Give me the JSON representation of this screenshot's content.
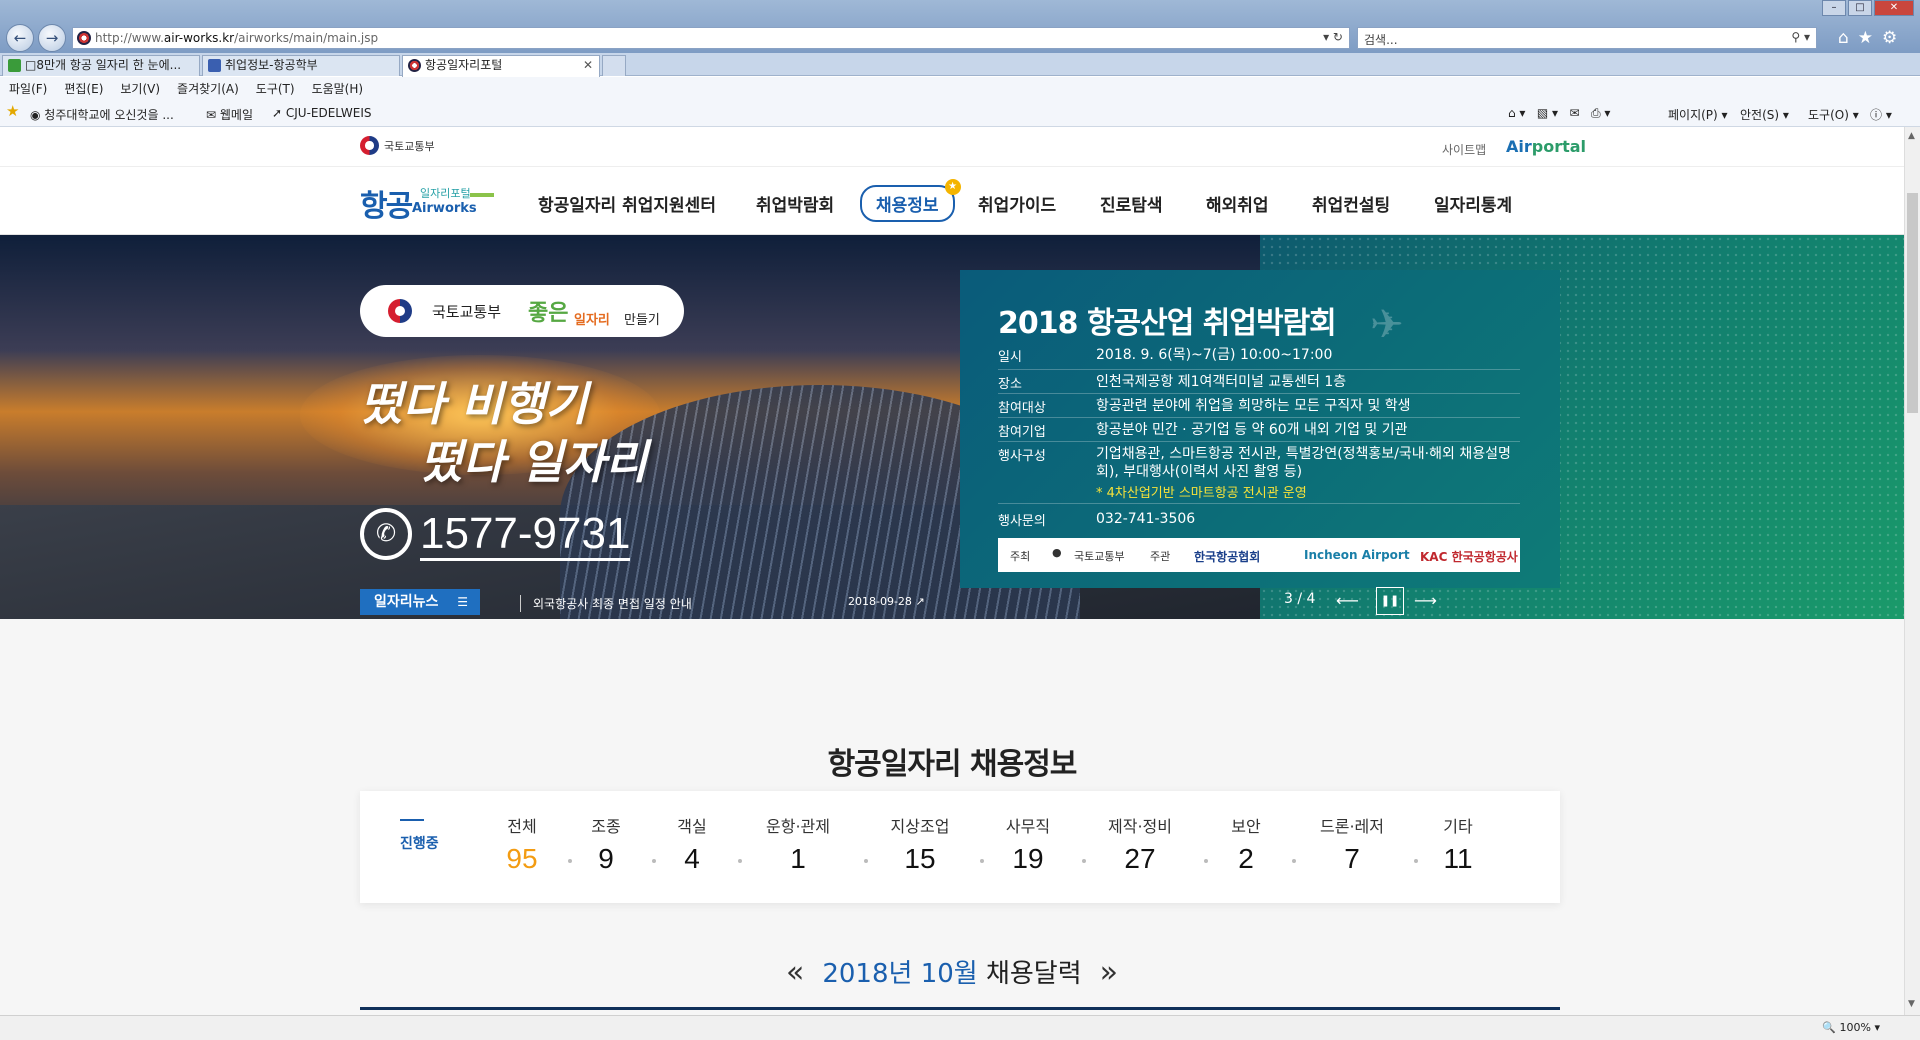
{
  "browser": {
    "url_prefix": "http://www.",
    "url_host": "air-works.kr",
    "url_path": "/airworks/main/main.jsp",
    "search_placeholder": "검색...",
    "tabs": [
      {
        "label": "□8만개 항공 일자리 한 눈에..."
      },
      {
        "label": "취업정보-항공학부"
      },
      {
        "label": "항공일자리포털"
      }
    ],
    "menu": [
      "파일(F)",
      "편집(E)",
      "보기(V)",
      "즐겨찾기(A)",
      "도구(T)",
      "도움말(H)"
    ],
    "favorites": [
      "청주대학교에 오신것을 ...",
      "웹메일",
      "CJU-EDELWEIS"
    ],
    "commands": [
      "페이지(P) ▾",
      "안전(S) ▾",
      "도구(O) ▾"
    ],
    "zoom": "100%"
  },
  "site": {
    "ministry": "국토교통부",
    "sitemap": "사이트맵",
    "airportal_a": "Air",
    "airportal_b": "portal",
    "logo_big": "항공",
    "logo_small": "일자리포털",
    "logo_sub": "Airworks",
    "nav": [
      "항공일자리 취업지원센터",
      "취업박람회",
      "채용정보",
      "취업가이드",
      "진로탐색",
      "해외취업",
      "취업컨설팅",
      "일자리통계"
    ]
  },
  "hero": {
    "pill_ministry": "국토교통부",
    "pill_good": "좋은",
    "pill_jobs": "일자리",
    "pill_make": "만들기",
    "slogan_1": "떴다 비행기",
    "slogan_2": "떴다 일자리",
    "phone": "1577-9731",
    "news_tag": "일자리뉴스",
    "news_text": "외국항공사 최종 면접 일정 안내",
    "news_date": "2018-09-28",
    "slide_counter": "3 / 4"
  },
  "event": {
    "title": "2018 항공산업 취업박람회",
    "rows": [
      {
        "k": "일시",
        "v": "2018. 9. 6(목)~7(금) 10:00~17:00"
      },
      {
        "k": "장소",
        "v": "인천국제공항 제1여객터미널 교통센터 1층"
      },
      {
        "k": "참여대상",
        "v": "항공관련 분야에 취업을 희망하는 모든 구직자 및 학생"
      },
      {
        "k": "참여기업",
        "v": "항공분야 민간 · 공기업 등 약 60개 내외 기업 및 기관"
      },
      {
        "k": "행사구성",
        "v": "기업채용관, 스마트항공 전시관, 특별강연(정책홍보/국내·해외 채용설명회), 부대행사(이력서 사진 촬영 등)"
      },
      {
        "k": "행사문의",
        "v": "032-741-3506"
      }
    ],
    "note": "* 4차산업기반 스마트항공 전시관 운영",
    "host_label": "주최",
    "host": "국토교통부",
    "organizer_label": "주관",
    "organizers": [
      "한국항공협회",
      "Incheon Airport",
      "KAC 한국공항공사"
    ]
  },
  "recruit": {
    "title": "항공일자리 채용정보",
    "status": "진행중",
    "categories": [
      {
        "name": "전체",
        "count": "95"
      },
      {
        "name": "조종",
        "count": "9"
      },
      {
        "name": "객실",
        "count": "4"
      },
      {
        "name": "운항·관제",
        "count": "1"
      },
      {
        "name": "지상조업",
        "count": "15"
      },
      {
        "name": "사무직",
        "count": "19"
      },
      {
        "name": "제작·정비",
        "count": "27"
      },
      {
        "name": "보안",
        "count": "2"
      },
      {
        "name": "드론·레저",
        "count": "7"
      },
      {
        "name": "기타",
        "count": "11"
      }
    ]
  },
  "calendar": {
    "month": "2018년 10월",
    "label": "채용달력"
  },
  "colors": {
    "brand_blue": "#1a5fae",
    "accent_orange": "#f39c12",
    "teal": "#12806f"
  }
}
